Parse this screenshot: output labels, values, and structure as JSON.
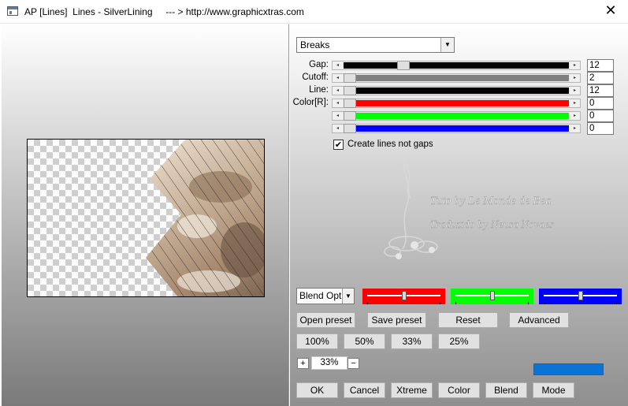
{
  "window": {
    "title": "AP [Lines]  Lines - SilverLining     --- > http://www.graphicxtras.com",
    "close_glyph": "✕"
  },
  "mode_select": {
    "value": "Breaks"
  },
  "sliders": [
    {
      "label": "Gap:",
      "value": "12",
      "fill_color": "#000000",
      "position": 0.25
    },
    {
      "label": "Cutoff:",
      "value": "2",
      "fill_color": "#808080",
      "position": 0.0
    },
    {
      "label": "Line:",
      "value": "12",
      "fill_color": "#000000",
      "position": 0.0
    },
    {
      "label": "Color[R]:",
      "value": "0",
      "fill_color": "#ff0000",
      "position": 0.0
    },
    {
      "label": "",
      "value": "0",
      "fill_color": "#00ff00",
      "position": 0.0
    },
    {
      "label": "",
      "value": "0",
      "fill_color": "#0000ff",
      "position": 0.0
    }
  ],
  "checkbox": {
    "label": "Create lines not gaps",
    "checked": true
  },
  "watermark": {
    "line1": "Tuto by Le Monde de Bea",
    "line2": "Traduzido by Neusa Novaes"
  },
  "blend_select": {
    "value": "Blend Options"
  },
  "color_swatches": [
    {
      "color": "#ff0000",
      "position": 0.5
    },
    {
      "color": "#00ff00",
      "position": 0.5
    },
    {
      "color": "#0000ff",
      "position": 0.5
    }
  ],
  "buttons": {
    "open_preset": "Open preset",
    "save_preset": "Save preset",
    "reset": "Reset",
    "advanced": "Advanced",
    "zoom100": "100%",
    "zoom50": "50%",
    "zoom33": "33%",
    "zoom25": "25%",
    "ok": "OK",
    "cancel": "Cancel",
    "xtreme": "Xtreme",
    "color": "Color",
    "blend": "Blend",
    "mode": "Mode"
  },
  "zoom": {
    "plus": "+",
    "value": "33%",
    "minus": "−"
  },
  "colors": {
    "accent_blue": "#0a74d6",
    "preview_checker": "#cfcfcf"
  }
}
